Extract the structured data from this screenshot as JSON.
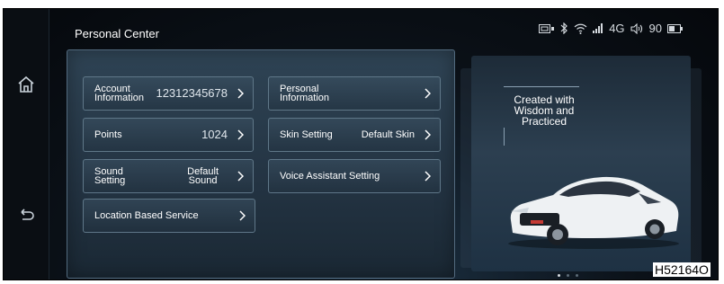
{
  "header": {
    "title": "Personal Center",
    "status": {
      "network": "4G",
      "volume": "90"
    }
  },
  "menu": [
    {
      "label_line1": "Account",
      "label_line2": "Information",
      "value": "12312345678"
    },
    {
      "label_line1": "Personal",
      "label_line2": "Information",
      "value": ""
    },
    {
      "label": "Points",
      "value": "1024"
    },
    {
      "label": "Skin Setting",
      "value": "Default Skin"
    },
    {
      "label_line1": "Sound",
      "label_line2": "Setting",
      "value_line1": "Default",
      "value_line2": "Sound"
    },
    {
      "label": "Voice Assistant Setting",
      "value": ""
    },
    {
      "label": "Location Based Service",
      "value": ""
    }
  ],
  "promo": {
    "line1": "Created with",
    "line2": "Wisdom and",
    "line3": "Practiced"
  },
  "pager": {
    "current": 1,
    "total": 3
  },
  "figure_label": "H52164O",
  "colors": {
    "background": "#0b1118",
    "panel": "#2a3d4d",
    "item_border": "#5f7788",
    "text": "#ffffff"
  },
  "icons": [
    "home-icon",
    "back-icon",
    "usb-icon",
    "bluetooth-icon",
    "wifi-icon",
    "signal-icon",
    "volume-icon",
    "battery-icon",
    "chevron-right-icon"
  ]
}
